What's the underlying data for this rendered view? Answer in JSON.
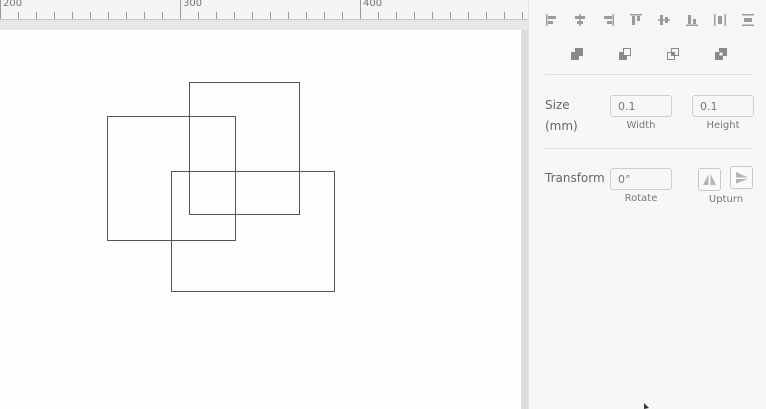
{
  "ruler": {
    "labels": [
      "200",
      "300",
      "400"
    ]
  },
  "align_tools": [
    {
      "name": "align-left-icon"
    },
    {
      "name": "align-center-horizontal-icon"
    },
    {
      "name": "align-right-icon"
    },
    {
      "name": "align-top-icon"
    },
    {
      "name": "align-center-vertical-icon"
    },
    {
      "name": "align-bottom-icon"
    },
    {
      "name": "distribute-horizontal-icon"
    },
    {
      "name": "distribute-vertical-icon"
    }
  ],
  "boolean_tools": [
    {
      "name": "union-icon"
    },
    {
      "name": "subtract-icon"
    },
    {
      "name": "intersect-icon"
    },
    {
      "name": "exclude-icon"
    }
  ],
  "size": {
    "label": "Size",
    "unit": "(mm)",
    "width_placeholder": "0.1",
    "height_placeholder": "0.1",
    "width_label": "Width",
    "height_label": "Height"
  },
  "transform": {
    "label": "Transform",
    "rotate_placeholder": "0°",
    "rotate_label": "Rotate",
    "upturn_label": "Upturn"
  },
  "colors": {
    "shape_stroke": "#555555",
    "icon_color": "#9a9a9a",
    "icon_dark": "#8a8a8a"
  }
}
